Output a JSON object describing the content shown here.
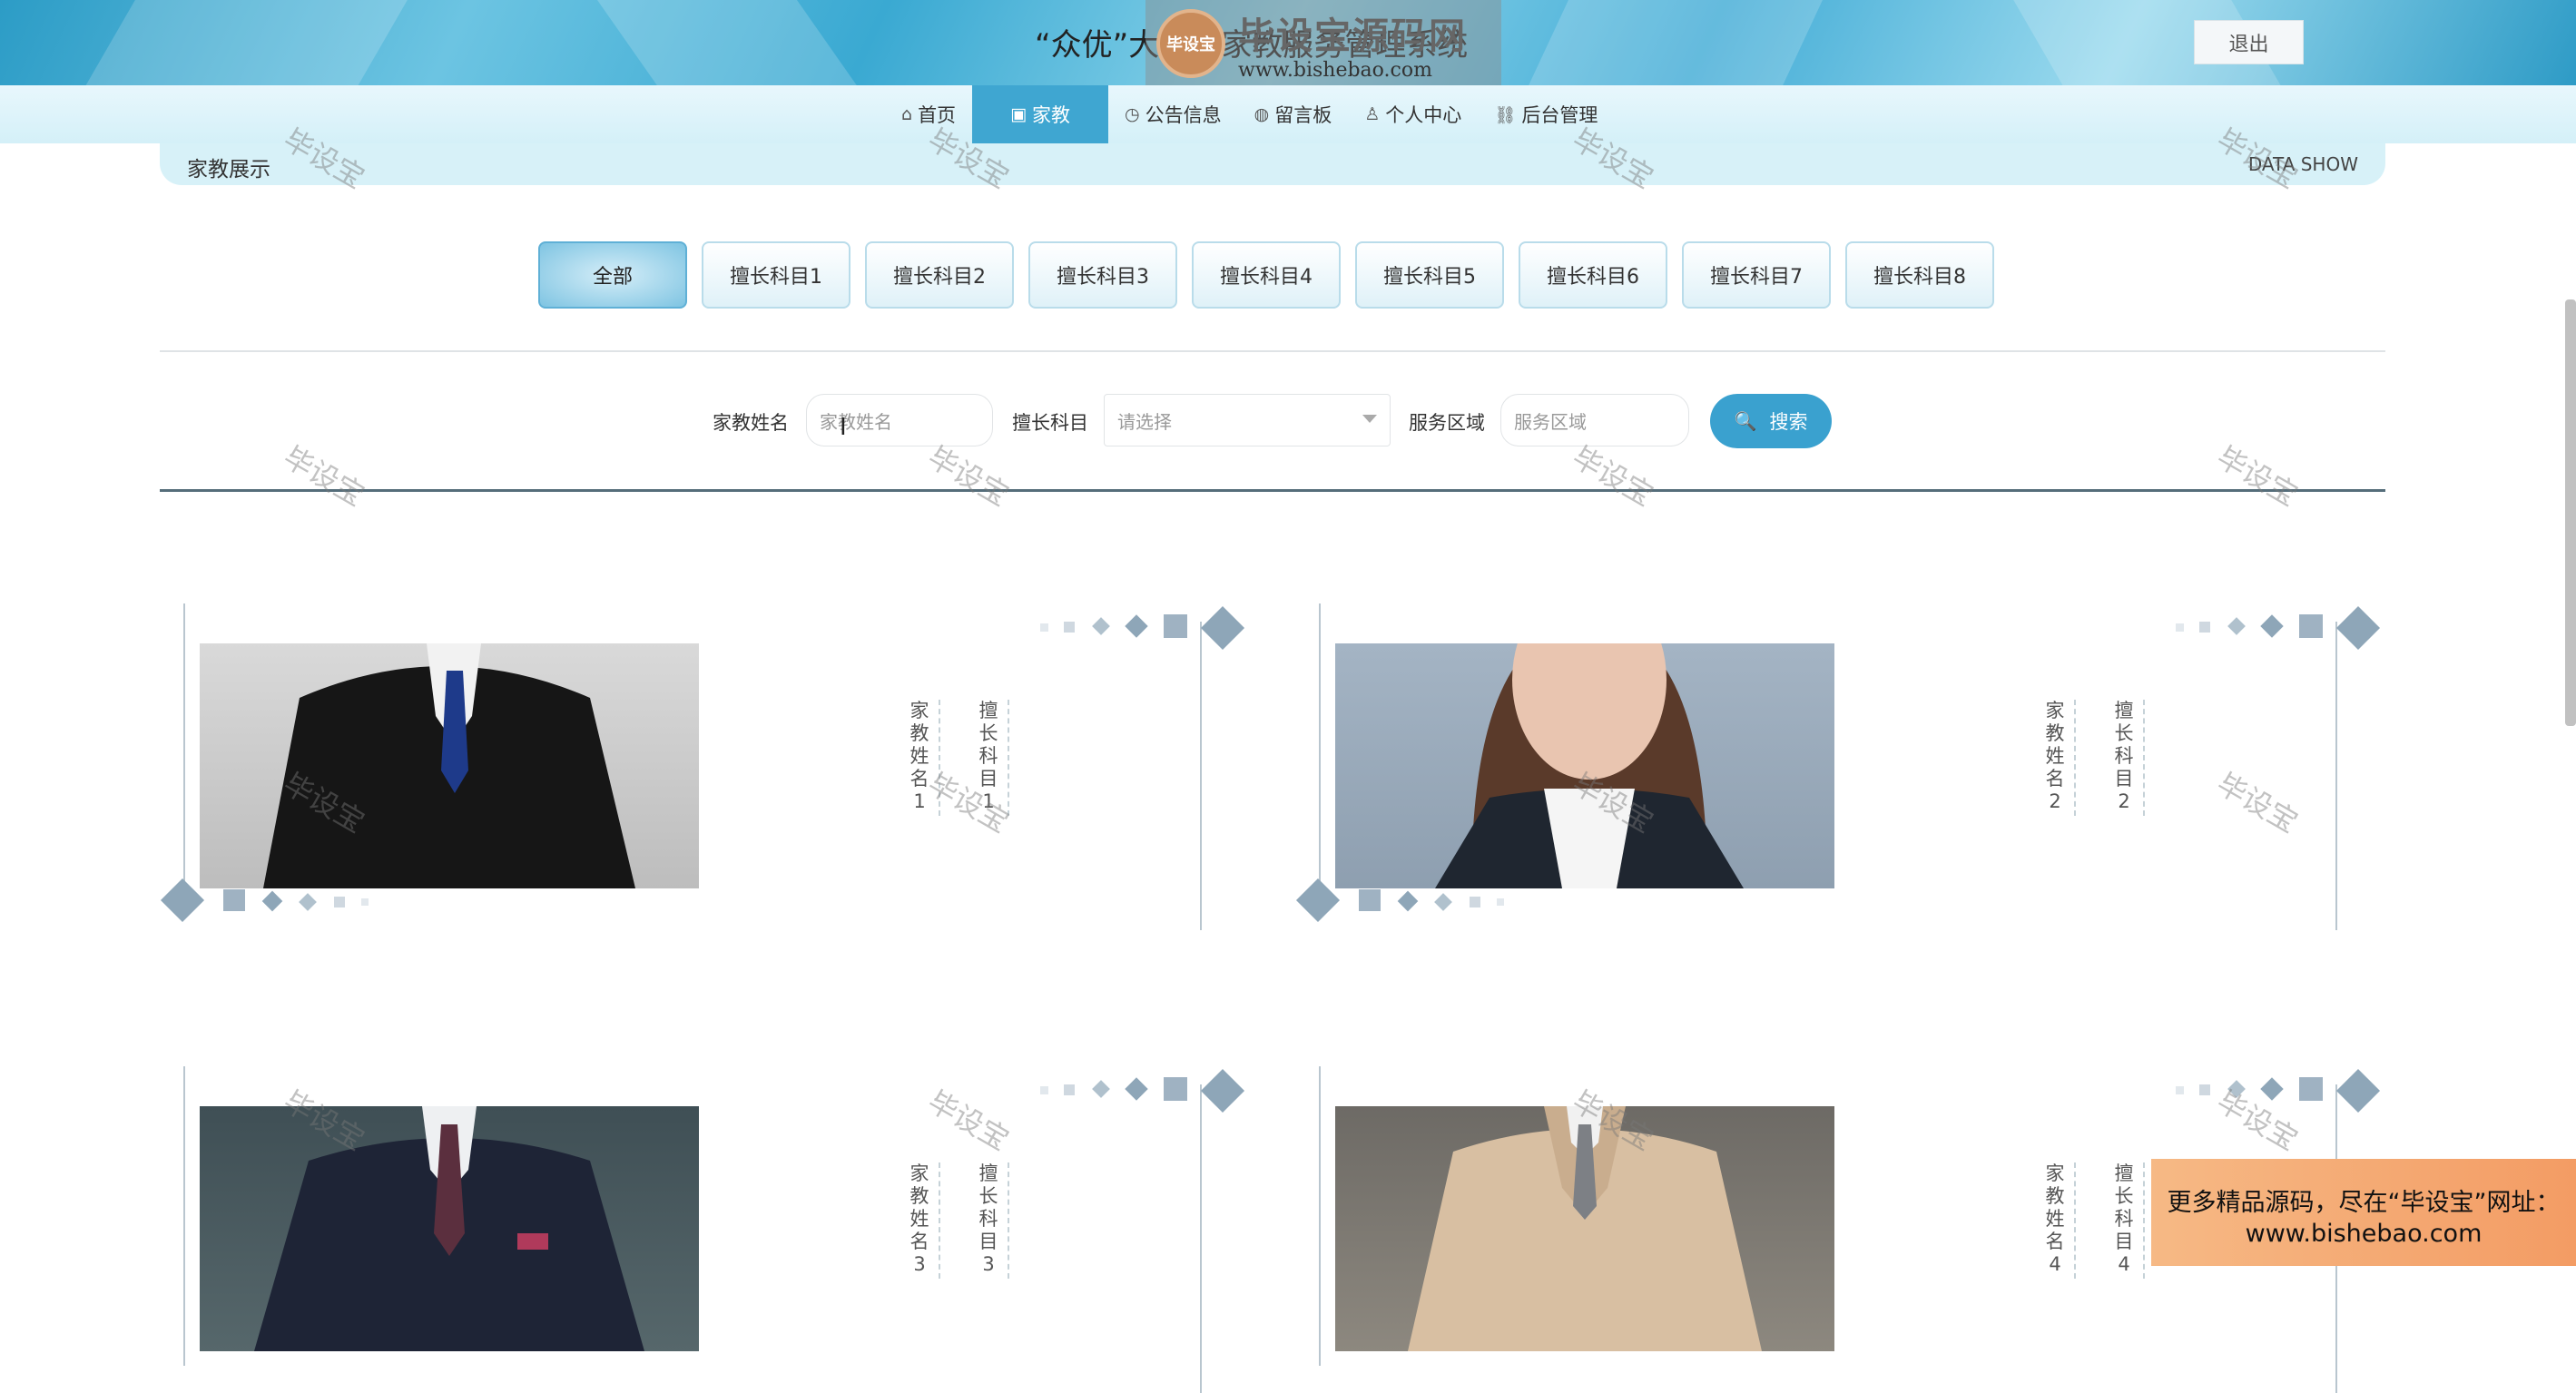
{
  "header": {
    "site_title": "“众优”大学生家教服务管理系统",
    "logout_label": "退出"
  },
  "watermark_logo": {
    "badge_text": "毕设宝",
    "big_text": "毕设宝源码网",
    "url": "www.bishebao.com"
  },
  "nav": {
    "items": [
      {
        "label": "首页",
        "icon": "home-icon",
        "active": false
      },
      {
        "label": "家教",
        "icon": "gift-icon",
        "active": true
      },
      {
        "label": "公告信息",
        "icon": "clock-icon",
        "active": false
      },
      {
        "label": "留言板",
        "icon": "globe-icon",
        "active": false
      },
      {
        "label": "个人中心",
        "icon": "user-icon",
        "active": false
      },
      {
        "label": "后台管理",
        "icon": "link-icon",
        "active": false
      }
    ]
  },
  "section": {
    "title": "家教展示",
    "subtitle_en": "DATA SHOW"
  },
  "categories": [
    {
      "label": "全部",
      "active": true
    },
    {
      "label": "擅长科目1",
      "active": false
    },
    {
      "label": "擅长科目2",
      "active": false
    },
    {
      "label": "擅长科目3",
      "active": false
    },
    {
      "label": "擅长科目4",
      "active": false
    },
    {
      "label": "擅长科目5",
      "active": false
    },
    {
      "label": "擅长科目6",
      "active": false
    },
    {
      "label": "擅长科目7",
      "active": false
    },
    {
      "label": "擅长科目8",
      "active": false
    }
  ],
  "search": {
    "name_label": "家教姓名",
    "name_placeholder": "家教姓名",
    "subject_label": "擅长科目",
    "subject_placeholder": "请选择",
    "area_label": "服务区域",
    "area_placeholder": "服务区域",
    "button_label": "搜索"
  },
  "tutors": [
    {
      "name": "家教姓名1",
      "subject": "擅长科目1"
    },
    {
      "name": "家教姓名2",
      "subject": "擅长科目2"
    },
    {
      "name": "家教姓名3",
      "subject": "擅长科目3"
    },
    {
      "name": "家教姓名4",
      "subject": "擅长科目4"
    }
  ],
  "watermark_text": "毕设宝",
  "promo": {
    "line1": "更多精品源码，尽在“毕设宝”网址：",
    "line2": "www.bishebao.com"
  },
  "colors": {
    "accent": "#3fa6d1",
    "search_button": "#3aa1cf",
    "banner": "#d7f1f8",
    "promo": "#f39c64"
  }
}
